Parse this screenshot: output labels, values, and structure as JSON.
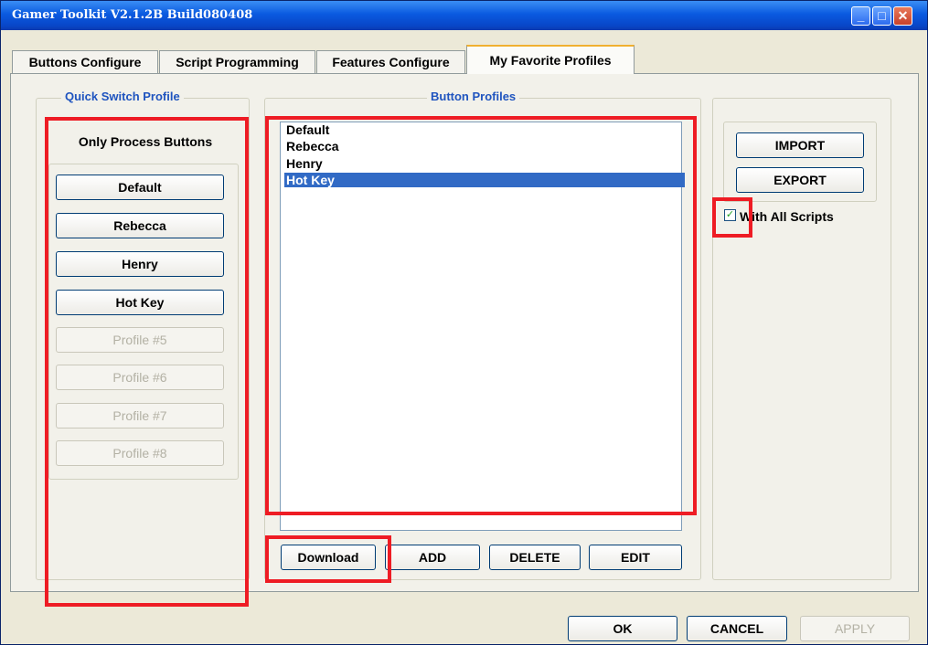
{
  "window": {
    "title": "Gamer Toolkit V2.1.2B Build080408"
  },
  "titlebar_buttons": {
    "minimize": "minimize-icon",
    "maximize": "maximize-icon",
    "close": "close-icon"
  },
  "tabs": [
    {
      "label": "Buttons Configure"
    },
    {
      "label": "Script Programming"
    },
    {
      "label": "Features Configure"
    },
    {
      "label": "My Favorite Profiles"
    }
  ],
  "quick_switch": {
    "legend": "Quick Switch Profile",
    "header": "Only Process Buttons",
    "buttons": [
      "Default",
      "Rebecca",
      "Henry",
      "Hot Key",
      "Profile #5",
      "Profile #6",
      "Profile #7",
      "Profile #8"
    ]
  },
  "button_profiles": {
    "legend": "Button Profiles",
    "items": [
      "Default",
      "Rebecca",
      "Henry",
      "Hot Key"
    ],
    "selected": "Hot Key",
    "actions": {
      "download": "Download",
      "add": "ADD",
      "delete": "DELETE",
      "edit": "EDIT"
    }
  },
  "import_export": {
    "import": "IMPORT",
    "export": "EXPORT",
    "with_all_scripts": {
      "label": "With All Scripts",
      "checked": true
    }
  },
  "footer": {
    "ok": "OK",
    "cancel": "CANCEL",
    "apply": "APPLY"
  },
  "colors": {
    "highlight": "#ee1c24",
    "selection": "#316ac5",
    "legend": "#1f54bf"
  }
}
